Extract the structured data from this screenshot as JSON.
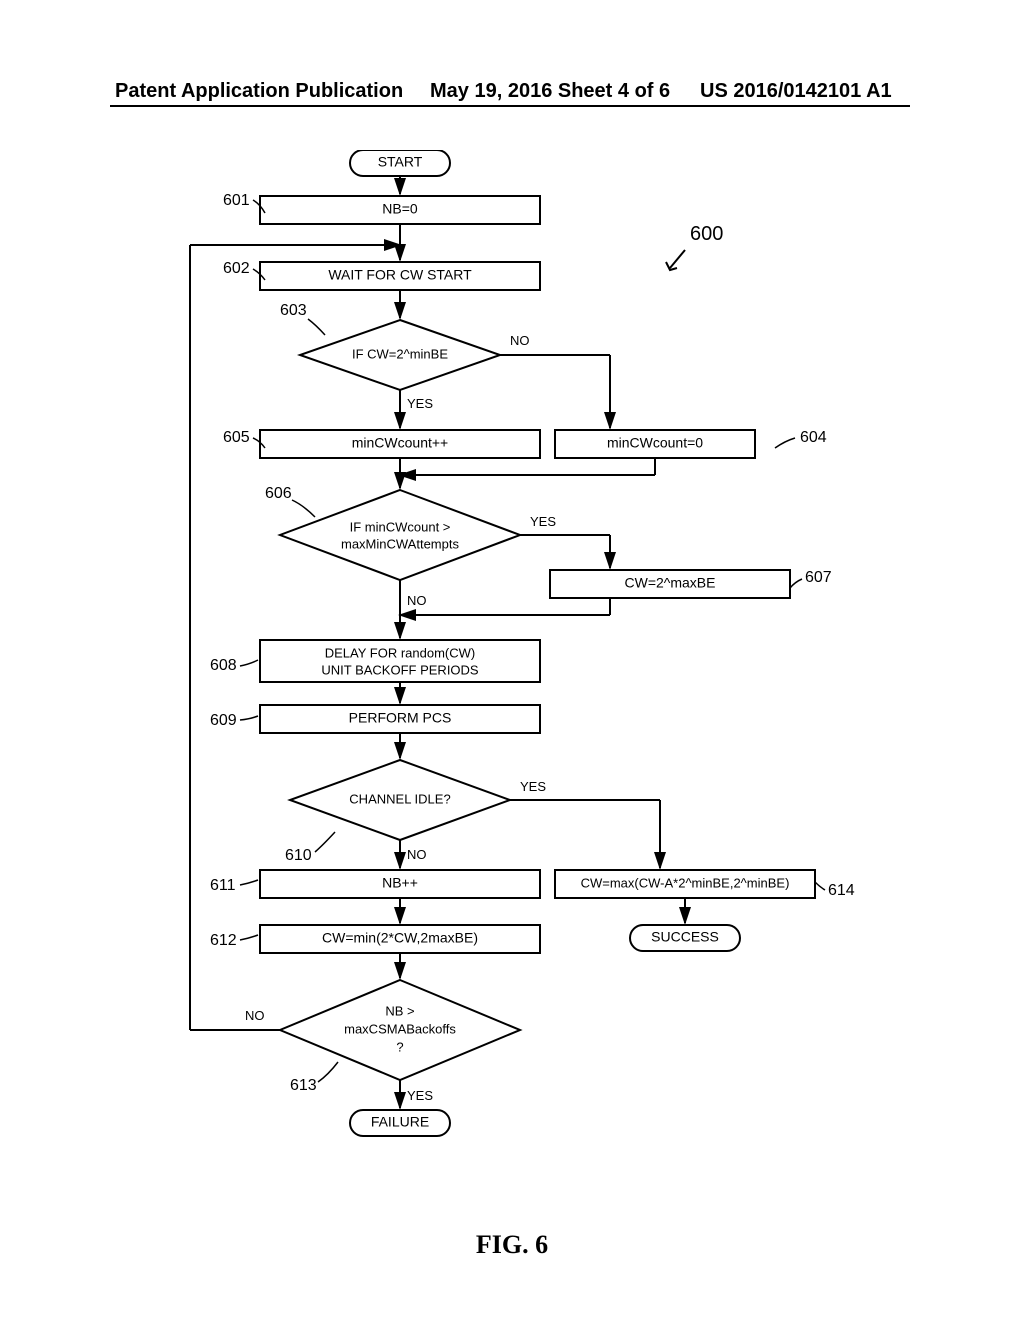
{
  "header": {
    "left": "Patent Application Publication",
    "center": "May 19, 2016  Sheet 4 of 6",
    "right": "US 2016/0142101 A1"
  },
  "figure_label": "FIG. 6",
  "diagram_ref": "600",
  "nodes": {
    "start": "START",
    "n601": "NB=0",
    "n602": "WAIT FOR CW START",
    "n603": "IF CW=2^minBE",
    "n604": "minCWcount=0",
    "n605": "minCWcount++",
    "n606_l1": "IF minCWcount >",
    "n606_l2": "maxMinCWAttempts",
    "n607": "CW=2^maxBE",
    "n608_l1": "DELAY FOR random(CW)",
    "n608_l2": "UNIT BACKOFF PERIODS",
    "n609": "PERFORM PCS",
    "n610": "CHANNEL IDLE?",
    "n611": "NB++",
    "n612": "CW=min(2*CW,2maxBE)",
    "n613_l1": "NB >",
    "n613_l2": "maxCSMABackoffs",
    "n613_l3": "?",
    "n614": "CW=max(CW-A*2^minBE,2^minBE)",
    "success": "SUCCESS",
    "failure": "FAILURE"
  },
  "labels": {
    "l601": "601",
    "l602": "602",
    "l603": "603",
    "l604": "604",
    "l605": "605",
    "l606": "606",
    "l607": "607",
    "l608": "608",
    "l609": "609",
    "l610": "610",
    "l611": "611",
    "l612": "612",
    "l613": "613",
    "l614": "614"
  },
  "edges": {
    "yes": "YES",
    "no": "NO"
  }
}
